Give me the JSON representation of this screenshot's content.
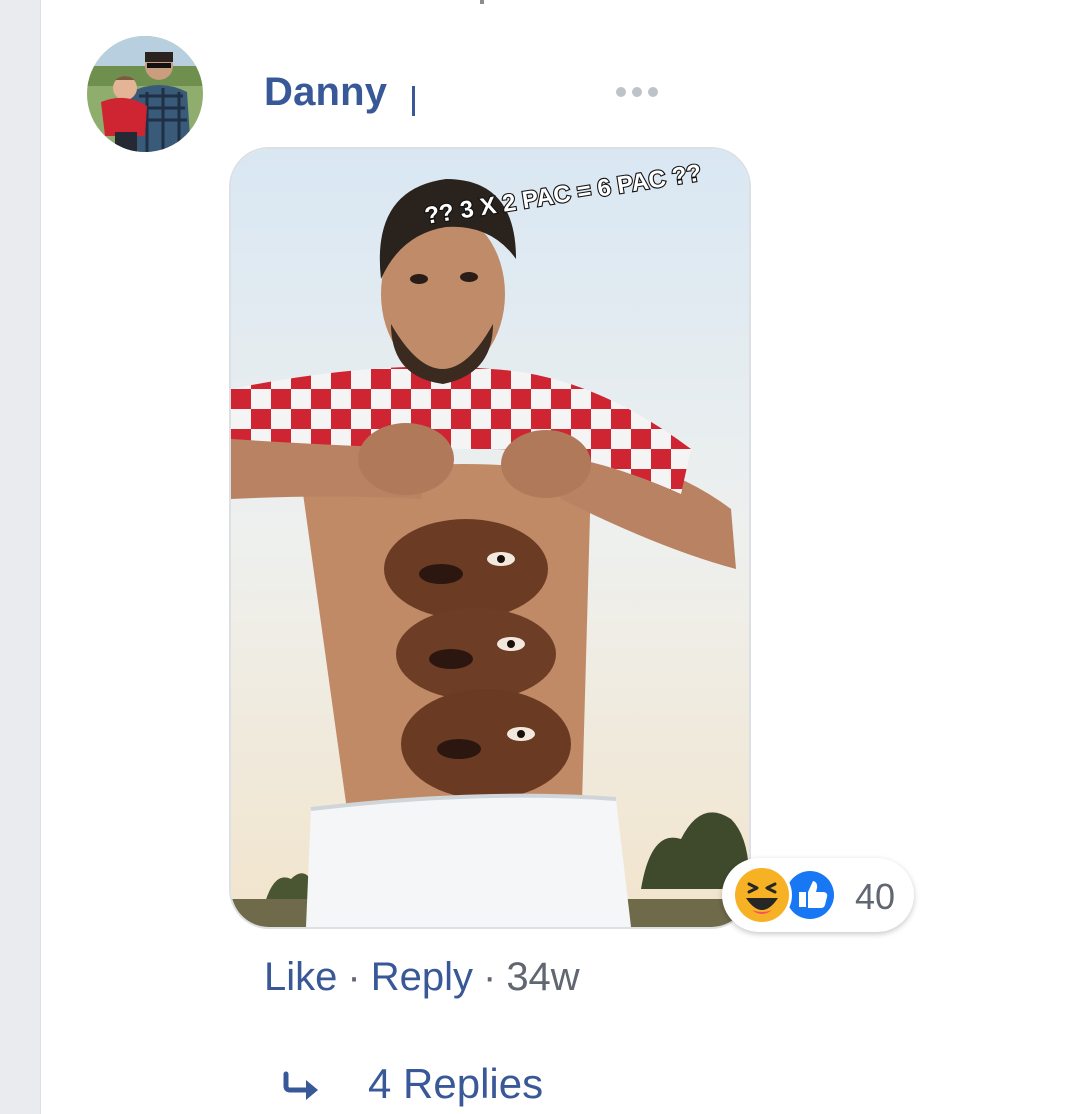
{
  "comment": {
    "author": "Danny",
    "more_icon": "more-horizontal-icon",
    "photo": {
      "caption_text": "?? 3 X 2 PAC = 6 PAC ??"
    },
    "reactions": {
      "icons": [
        "laugh-reaction-icon",
        "like-reaction-icon"
      ],
      "count": "40"
    },
    "actions": {
      "like_label": "Like",
      "reply_label": "Reply",
      "separator": "·",
      "timestamp": "34w"
    },
    "replies": {
      "icon": "reply-arrow-icon",
      "label": "4 Replies"
    }
  },
  "colors": {
    "link": "#385898",
    "meta": "#606770",
    "rail": "#e9ebee"
  }
}
